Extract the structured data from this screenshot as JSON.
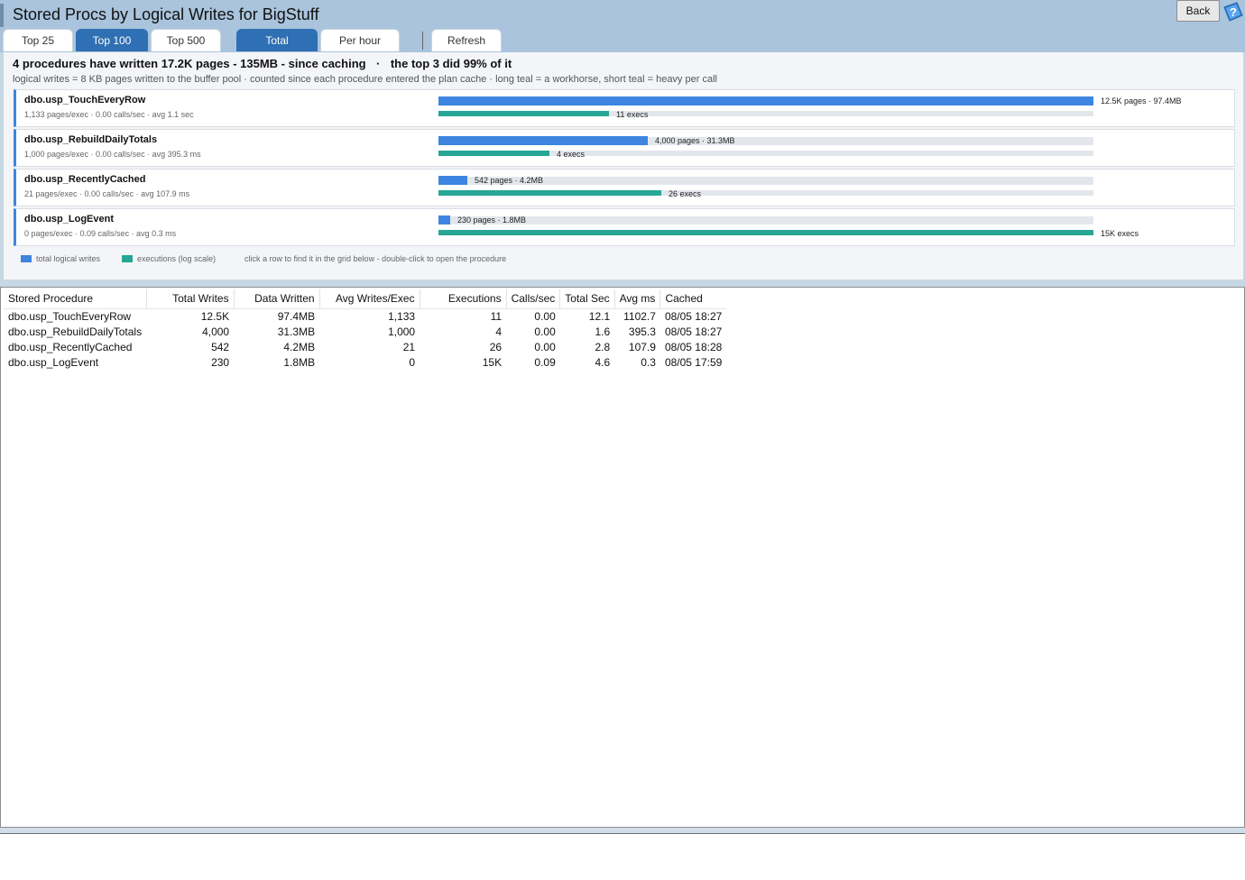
{
  "header": {
    "title": "Stored Procs by Logical Writes for BigStuff",
    "back_label": "Back",
    "help_icon": "help-question-icon"
  },
  "toolbar": {
    "top_tabs": [
      {
        "label": "Top 25",
        "active": false
      },
      {
        "label": "Top 100",
        "active": true
      },
      {
        "label": "Top 500",
        "active": false
      }
    ],
    "mode_tabs": [
      {
        "label": "Total",
        "active": true
      },
      {
        "label": "Per hour",
        "active": false
      }
    ],
    "refresh_label": "Refresh"
  },
  "summary": {
    "headline": "4 procedures have written 17.2K pages - 135MB - since caching",
    "separator": "·",
    "highlight": "the top 3 did 99% of it",
    "note": "logical writes = 8 KB pages written to the buffer pool   ·   counted since each procedure entered the plan cache   ·   long teal = a workhorse, short teal = heavy per call"
  },
  "procedures": [
    {
      "name": "dbo.usp_TouchEveryRow",
      "detail": "1,133 pages/exec · 0.00 calls/sec · avg 1.1 sec",
      "writes_label": "12.5K pages · 97.4MB",
      "execs_label": "11 execs",
      "writes_fraction": 1.0,
      "execs_fraction": 0.26
    },
    {
      "name": "dbo.usp_RebuildDailyTotals",
      "detail": "1,000 pages/exec · 0.00 calls/sec · avg 395.3 ms",
      "writes_label": "4,000 pages · 31.3MB",
      "execs_label": "4 execs",
      "writes_fraction": 0.32,
      "execs_fraction": 0.17
    },
    {
      "name": "dbo.usp_RecentlyCached",
      "detail": "21 pages/exec · 0.00 calls/sec · avg 107.9 ms",
      "writes_label": "542 pages · 4.2MB",
      "execs_label": "26 execs",
      "writes_fraction": 0.044,
      "execs_fraction": 0.34
    },
    {
      "name": "dbo.usp_LogEvent",
      "detail": "0 pages/exec · 0.09 calls/sec · avg 0.3 ms",
      "writes_label": "230 pages · 1.8MB",
      "execs_label": "15K execs",
      "writes_fraction": 0.018,
      "execs_fraction": 1.0
    }
  ],
  "legend": {
    "writes": "total logical writes",
    "execs": "executions (log scale)",
    "hint": "click a row to find it in the grid below - double-click to open the procedure"
  },
  "colors": {
    "writes_bar": "#3d85e0",
    "execs_bar": "#27a595",
    "header_bg": "#a9c4dc",
    "active_tab": "#2f6fb3"
  },
  "grid": {
    "columns": [
      "Stored Procedure",
      "Total Writes",
      "Data Written",
      "Avg Writes/Exec",
      "Executions",
      "Calls/sec",
      "Total Sec",
      "Avg ms",
      "Cached"
    ],
    "rows": [
      [
        "dbo.usp_TouchEveryRow",
        "12.5K",
        "97.4MB",
        "1,133",
        "11",
        "0.00",
        "12.1",
        "1102.7",
        "08/05 18:27"
      ],
      [
        "dbo.usp_RebuildDailyTotals",
        "4,000",
        "31.3MB",
        "1,000",
        "4",
        "0.00",
        "1.6",
        "395.3",
        "08/05 18:27"
      ],
      [
        "dbo.usp_RecentlyCached",
        "542",
        "4.2MB",
        "21",
        "26",
        "0.00",
        "2.8",
        "107.9",
        "08/05 18:28"
      ],
      [
        "dbo.usp_LogEvent",
        "230",
        "1.8MB",
        "0",
        "15K",
        "0.09",
        "4.6",
        "0.3",
        "08/05 17:59"
      ]
    ]
  }
}
